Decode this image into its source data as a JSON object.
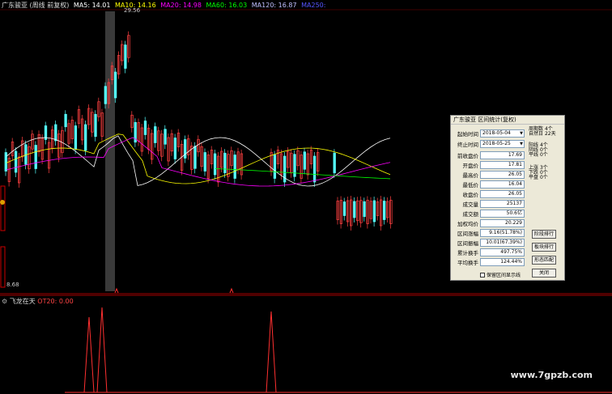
{
  "legend": {
    "stock": "广东骏亚 (周线 前复权)",
    "ma5": "MA5: 14.01",
    "ma10": "MA10: 14.16",
    "ma20": "MA20: 14.98",
    "ma60": "MA60: 16.03",
    "ma120": "MA120: 16.87",
    "ma250": "MA250:",
    "colors": {
      "ma5": "#ffffff",
      "ma10": "#ffff00",
      "ma20": "#ff00ff",
      "ma60": "#00ff00",
      "ma120": "#a0a0ff",
      "ma250": "#4444ff"
    }
  },
  "price_labels": {
    "high": "29.56",
    "low": "8.68"
  },
  "sub_legend": {
    "name": "飞龙在天",
    "value": "OT20: 0.00"
  },
  "watermark": "www.7gpzb.com",
  "dialog": {
    "title": "广东骏亚 区间统计(复权)",
    "start_label": "起始时间",
    "start_value": "2018-05-04",
    "end_label": "终止时间",
    "end_value": "2018-05-25",
    "fields": [
      {
        "label": "前收盘价",
        "value": "17.69"
      },
      {
        "label": "开盘价",
        "value": "17.81"
      },
      {
        "label": "最高价",
        "value": "26.05"
      },
      {
        "label": "最低价",
        "value": "16.04"
      },
      {
        "label": "收盘价",
        "value": "26.05"
      },
      {
        "label": "成交量",
        "value": "25137"
      },
      {
        "label": "成交额",
        "value": "50.6亿"
      },
      {
        "label": "加权均价",
        "value": "20.229"
      },
      {
        "label": "区间涨幅",
        "value": "9.16(51.78%)"
      },
      {
        "label": "区间振幅",
        "value": "10.01(67.39%)"
      },
      {
        "label": "累计换手",
        "value": "497.75%"
      },
      {
        "label": "平均换手",
        "value": "124.44%"
      }
    ],
    "side_top": [
      "周期数",
      "4个",
      "自然日",
      "22天"
    ],
    "side_mid": [
      "阳线",
      "4个",
      "阴线",
      "0个",
      "平线",
      "0个"
    ],
    "side_low": [
      "上涨",
      "3个",
      "下跌",
      "0个",
      "平盘",
      "0个"
    ],
    "buttons": [
      "阶段排行",
      "板块排行",
      "形态匹配",
      "关闭"
    ],
    "checkbox_label": "保留区间显示线"
  }
}
